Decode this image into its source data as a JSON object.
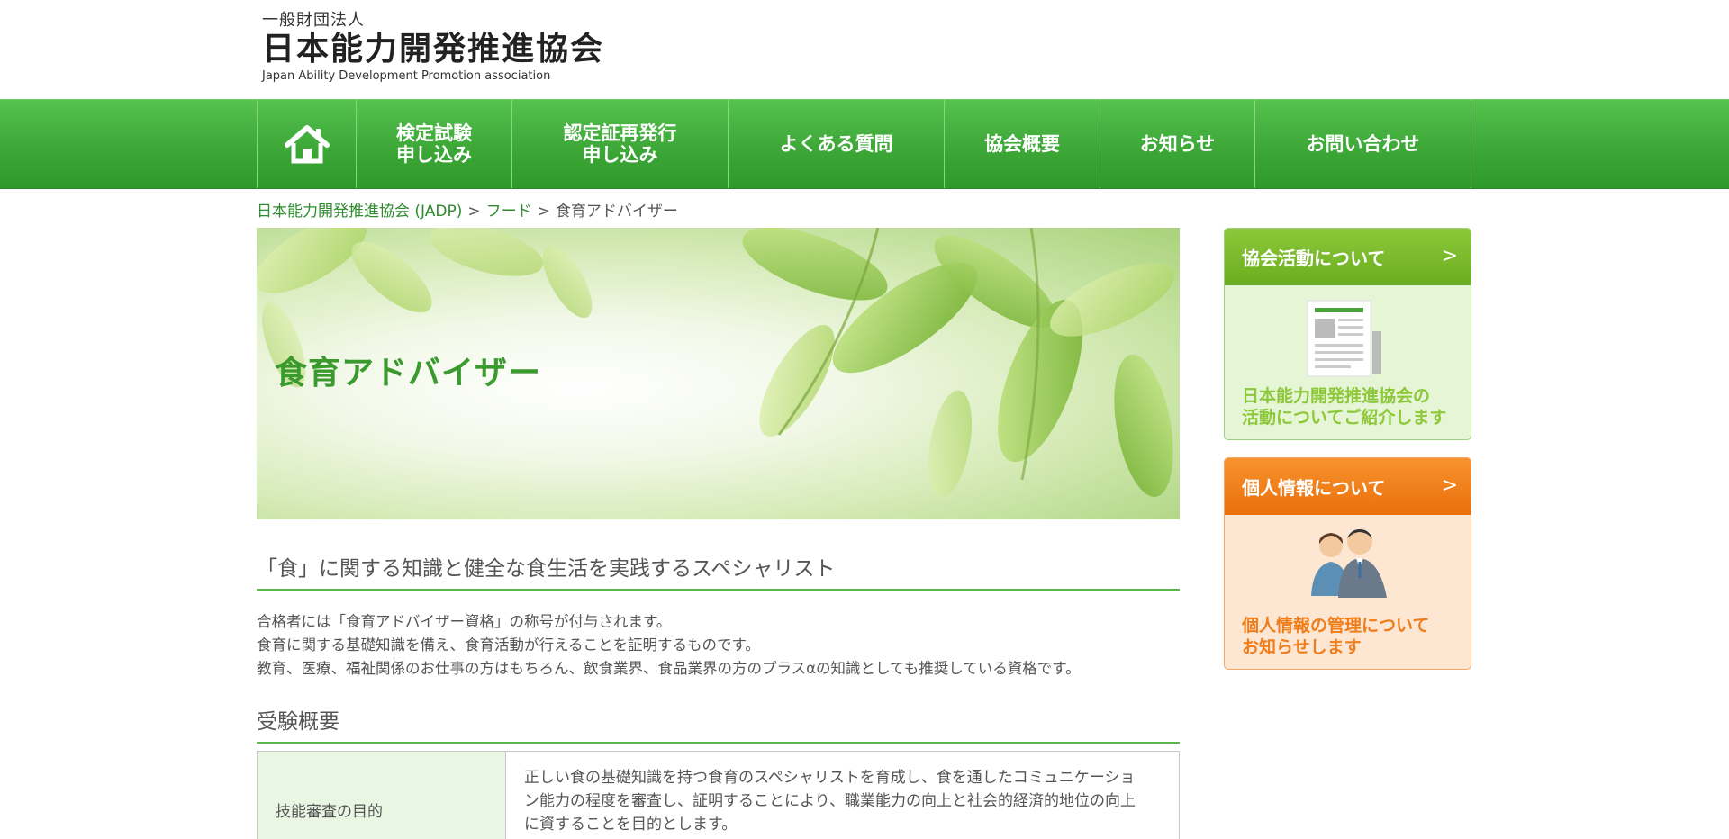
{
  "header": {
    "logo_sub": "一般財団法人",
    "logo_main": "日本能力開発推進協会",
    "logo_en": "Japan Ability Development Promotion association"
  },
  "nav": {
    "home_icon": "home-icon",
    "items": [
      {
        "line1": "検定試験",
        "line2": "申し込み"
      },
      {
        "line1": "認定証再発行",
        "line2": "申し込み"
      },
      {
        "line1": "よくある質問",
        "line2": ""
      },
      {
        "line1": "協会概要",
        "line2": ""
      },
      {
        "line1": "お知らせ",
        "line2": ""
      },
      {
        "line1": "お問い合わせ",
        "line2": ""
      }
    ]
  },
  "breadcrumb": {
    "home": "日本能力開発推進協会 (JADP)",
    "category": "フード",
    "current": "食育アドバイザー",
    "separator": ">"
  },
  "hero": {
    "title": "食育アドバイザー"
  },
  "lead": {
    "heading": "「食」に関する知識と健全な食生活を実践するスペシャリスト",
    "lines": [
      "合格者には「食育アドバイザー資格」の称号が付与されます。",
      "食育に関する基礎知識を備え、食育活動が行えることを証明するものです。",
      "教育、医療、福祉関係のお仕事の方はもちろん、飲食業界、食品業界の方のプラスαの知識としても推奨している資格です。"
    ]
  },
  "overview": {
    "heading": "受験概要",
    "rows": [
      {
        "label": "技能審査の目的",
        "lines": [
          "正しい食の基礎知識を持つ食育のスペシャリストを育成し、食を通したコミュニケーショ",
          "ン能力の程度を審査し、証明することにより、職業能力の向上と社会的経済的地位の向上",
          "に資することを目的とします。"
        ]
      }
    ]
  },
  "sidebar": {
    "cards": [
      {
        "title": "協会活動について",
        "chevron": ">",
        "line1": "日本能力開発推進協会の",
        "line2": "活動についてご紹介します",
        "color": "#6aad1e"
      },
      {
        "title": "個人情報について",
        "chevron": ">",
        "line1": "個人情報の管理について",
        "line2": "お知らせします",
        "color": "#ea6f0b"
      }
    ]
  },
  "colors": {
    "nav_green": "#3ba536",
    "accent_green": "#5cb548",
    "orange": "#ea6f0b"
  }
}
